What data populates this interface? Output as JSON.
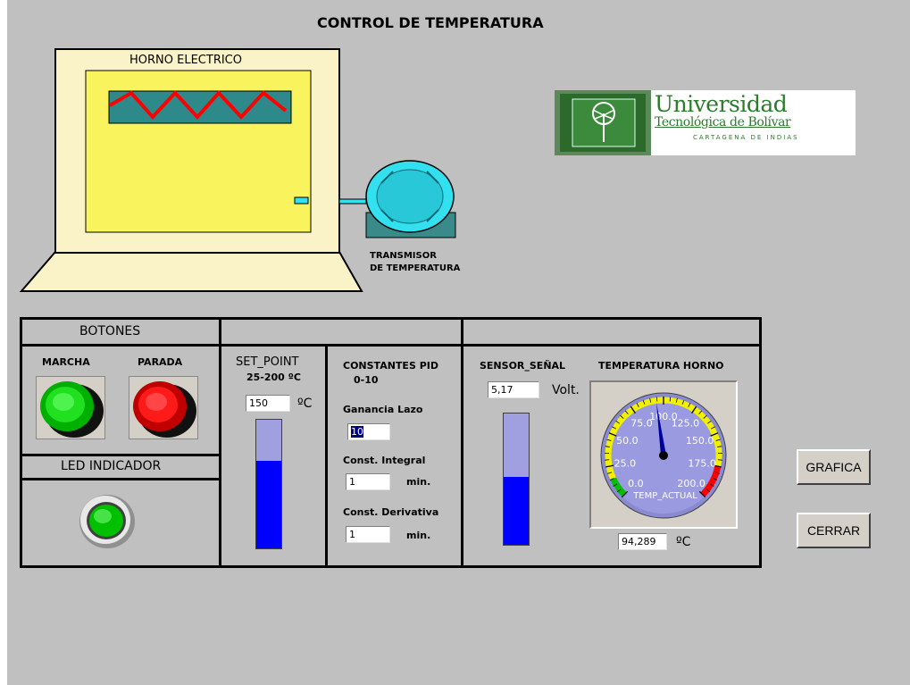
{
  "title": "CONTROL DE TEMPERATURA",
  "oven": {
    "label": "HORNO ELECTRICO"
  },
  "transmitter": {
    "label_line1": "TRANSMISOR",
    "label_line2": "DE TEMPERATURA"
  },
  "logo": {
    "line1": "Universidad",
    "line2": "Tecnológica de Bolívar",
    "line3": "CARTAGENA DE INDIAS"
  },
  "botones": {
    "header": "BOTONES",
    "marcha_label": "MARCHA",
    "parada_label": "PARADA"
  },
  "led": {
    "header": "LED INDICADOR",
    "state": "on",
    "color": "#00c000"
  },
  "setpoint": {
    "title": "SET_POINT",
    "range": "25-200 ºC",
    "value": "150",
    "unit": "ºC",
    "level": 0.68
  },
  "pid": {
    "title": "CONSTANTES PID",
    "range": "0-10",
    "ganancia_label": "Ganancia Lazo",
    "ganancia_value": "10",
    "integral_label": "Const. Integral",
    "integral_value": "1",
    "integral_unit": "min.",
    "derivativa_label": "Const. Derivativa",
    "derivativa_value": "1",
    "derivativa_unit": "min."
  },
  "sensor": {
    "title": "SENSOR_SEÑAL",
    "value": "5,17",
    "unit": "Volt.",
    "level": 0.52
  },
  "gauge": {
    "title": "TEMPERATURA HORNO",
    "caption": "TEMP_ACTUAL",
    "value": 94.289,
    "min": 0,
    "max": 200,
    "ticks": [
      "0.0",
      "25.0",
      "50.0",
      "75.0",
      "100.0",
      "125.0",
      "150.0",
      "175.0",
      "200.0"
    ],
    "readout": "94,289",
    "unit": "ºC"
  },
  "buttons": {
    "grafica": "GRAFICA",
    "cerrar": "CERRAR"
  },
  "colors": {
    "panel": "#c0c0c0",
    "oven_body": "#fbf3c8",
    "oven_window": "#f9f35e",
    "heater": "#2e8a8a",
    "coil": "#ff0000",
    "transmitter": "#33e0ef",
    "fill_blue": "#0000ff",
    "fill_empty": "#a0a0e0",
    "logo_green": "#2c7a2c"
  }
}
